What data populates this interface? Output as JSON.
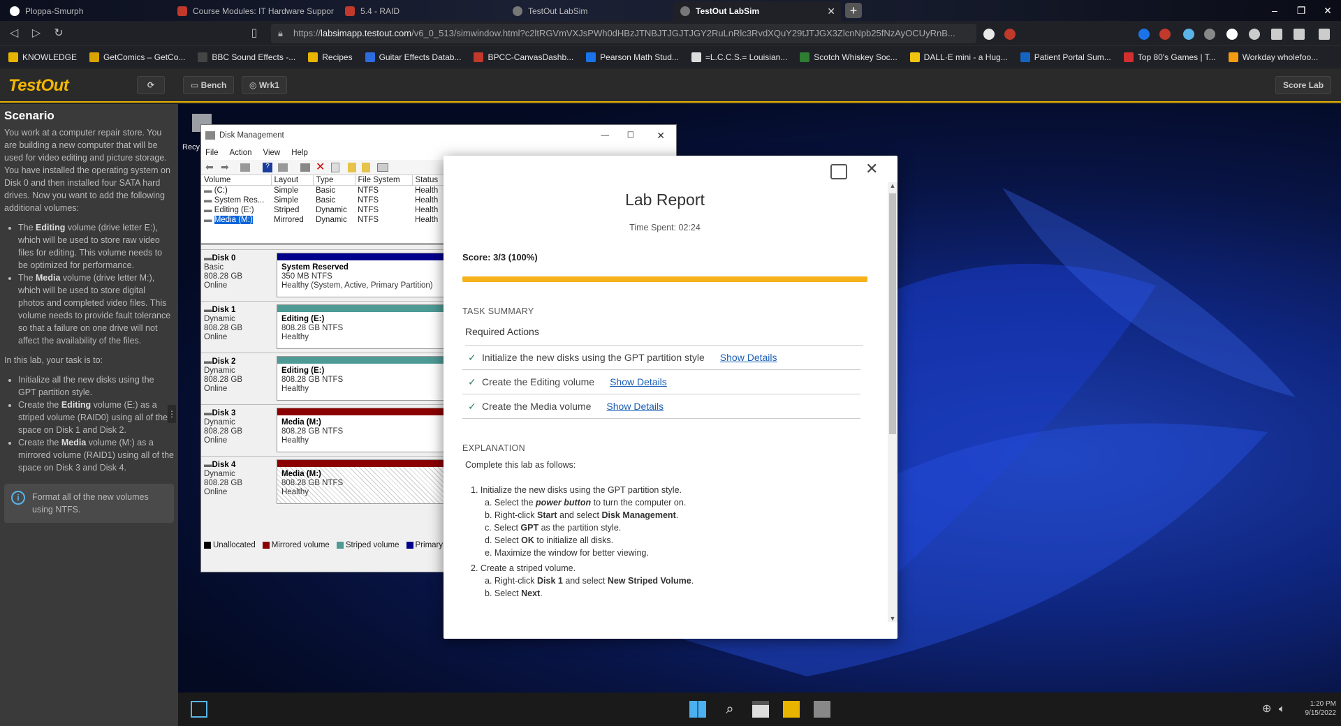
{
  "browser": {
    "tabs": [
      {
        "title": "Ploppa-Smurph",
        "color": "#444"
      },
      {
        "title": "Course Modules: IT Hardware Suppor",
        "color": "#c0392b"
      },
      {
        "title": "5.4 - RAID",
        "color": "#c0392b"
      },
      {
        "title": "TestOut LabSim",
        "color": "#777"
      },
      {
        "title": "TestOut LabSim",
        "color": "#777",
        "active": true
      }
    ],
    "url_prefix": "https://",
    "url_host": "labsimapp.testout.com",
    "url_rest": "/v6_0_513/simwindow.html?c2ltRGVmVXJsPWh0dHBzJTNBJTJGJTJGY2RuLnRlc3RvdXQuY29tJTJGX3ZlcnNpb25fNzAyOCUyRnB...",
    "bookmarks": [
      {
        "label": "KNOWLEDGE",
        "color": "#e8b400"
      },
      {
        "label": "GetComics – GetCo...",
        "color": "#d9a400"
      },
      {
        "label": "BBC Sound Effects -...",
        "color": "#444"
      },
      {
        "label": "Recipes",
        "color": "#e8b400"
      },
      {
        "label": "Guitar Effects Datab...",
        "color": "#2d6cdf"
      },
      {
        "label": "BPCC-CanvasDashb...",
        "color": "#c0392b"
      },
      {
        "label": "Pearson Math Stud...",
        "color": "#1a73e8"
      },
      {
        "label": "=L.C.C.S.= Louisian...",
        "color": "#ddd"
      },
      {
        "label": "Scotch Whiskey Soc...",
        "color": "#2e7d32"
      },
      {
        "label": "DALL·E mini - a Hug...",
        "color": "#f1c40f"
      },
      {
        "label": "Patient Portal Sum...",
        "color": "#1565c0"
      },
      {
        "label": "Top 80's Games | T...",
        "color": "#d32f2f"
      },
      {
        "label": "Workday wholefoo...",
        "color": "#f39c12"
      }
    ]
  },
  "app": {
    "logo": "TestOut",
    "bench": "Bench",
    "wrk": "Wrk1",
    "score_lab": "Score Lab"
  },
  "scenario": {
    "heading": "Scenario",
    "intro": "You work at a computer repair store. You are building a new computer that will be used for video editing and picture storage. You have installed the operating system on Disk 0 and then installed four SATA hard drives. Now you want to add the following additional volumes:",
    "vol_items": [
      {
        "pre": "The ",
        "bold": "Editing",
        "post": " volume (drive letter E:), which will be used to store raw video files for editing. This volume needs to be optimized for performance."
      },
      {
        "pre": "The ",
        "bold": "Media",
        "post": " volume (drive letter M:), which will be used to store digital photos and completed video files. This volume needs to provide fault tolerance so that a failure on one drive will not affect the availability of the files."
      }
    ],
    "task_intro": "In this lab, your task is to:",
    "tasks": [
      {
        "pre": "Initialize all the new disks using the GPT partition style.",
        "bold": "",
        "post": ""
      },
      {
        "pre": "Create the ",
        "bold": "Editing",
        "post": " volume (E:) as a striped volume (RAID0) using all of the space on Disk 1 and Disk 2."
      },
      {
        "pre": "Create the ",
        "bold": "Media",
        "post": " volume (M:) as a mirrored volume (RAID1) using all of the space on Disk 3 and Disk 4."
      }
    ],
    "tip": "Format all of the new volumes using NTFS."
  },
  "desktop": {
    "recycle": "Recy"
  },
  "disk_mgmt": {
    "title": "Disk Management",
    "menus": [
      "File",
      "Action",
      "View",
      "Help"
    ],
    "columns": [
      "Volume",
      "Layout",
      "Type",
      "File System",
      "Status"
    ],
    "volumes": [
      {
        "name": "(C:)",
        "layout": "Simple",
        "type": "Basic",
        "fs": "NTFS",
        "status": "Health"
      },
      {
        "name": "System Res...",
        "layout": "Simple",
        "type": "Basic",
        "fs": "NTFS",
        "status": "Health"
      },
      {
        "name": "Editing (E:)",
        "layout": "Striped",
        "type": "Dynamic",
        "fs": "NTFS",
        "status": "Health"
      },
      {
        "name": "Media (M:)",
        "layout": "Mirrored",
        "type": "Dynamic",
        "fs": "NTFS",
        "status": "Health"
      }
    ],
    "disks": [
      {
        "name": "Disk 0",
        "kind": "Basic",
        "size": "808.28 GB",
        "state": "Online",
        "part": "System Reserved",
        "detail": "350 MB NTFS",
        "health": "Healthy (System, Active, Primary Partition)",
        "bar": "#00008b"
      },
      {
        "name": "Disk 1",
        "kind": "Dynamic",
        "size": "808.28 GB",
        "state": "Online",
        "part": "Editing (E:)",
        "detail": "808.28 GB NTFS",
        "health": "Healthy",
        "bar": "#4e9a95"
      },
      {
        "name": "Disk 2",
        "kind": "Dynamic",
        "size": "808.28 GB",
        "state": "Online",
        "part": "Editing (E:)",
        "detail": "808.28 GB NTFS",
        "health": "Healthy",
        "bar": "#4e9a95"
      },
      {
        "name": "Disk 3",
        "kind": "Dynamic",
        "size": "808.28 GB",
        "state": "Online",
        "part": "Media (M:)",
        "detail": "808.28 GB NTFS",
        "health": "Healthy",
        "bar": "#8b0000"
      },
      {
        "name": "Disk 4",
        "kind": "Dynamic",
        "size": "808.28 GB",
        "state": "Online",
        "part": "Media (M:)",
        "detail": "808.28 GB NTFS",
        "health": "Healthy",
        "bar": "#8b0000"
      }
    ],
    "legend": [
      {
        "label": "Unallocated",
        "color": "#000"
      },
      {
        "label": "Mirrored volume",
        "color": "#8b0000"
      },
      {
        "label": "Striped volume",
        "color": "#4e9a95"
      },
      {
        "label": "Primary",
        "color": "#00008b"
      }
    ]
  },
  "report": {
    "title": "Lab Report",
    "time_spent": "Time Spent: 02:24",
    "score": "Score: 3/3 (100%)",
    "score_progress": 1.0,
    "task_summary": "TASK SUMMARY",
    "required": "Required Actions",
    "actions": [
      {
        "label": "Initialize the new disks using the GPT partition style",
        "link": "Show Details"
      },
      {
        "label": "Create the Editing volume",
        "link": "Show Details"
      },
      {
        "label": "Create the Media volume",
        "link": "Show Details"
      }
    ],
    "explanation": "EXPLANATION",
    "exp_intro": "Complete this lab as follows:",
    "step1": "1. Initialize the new disks using the GPT partition style.",
    "step1_subs": [
      {
        "pre": "a. Select the ",
        "bold": "power button",
        "italic": true,
        "post": " to turn the computer on."
      },
      {
        "pre": "b. Right-click ",
        "bold": "Start",
        "post": " and select ",
        "bold2": "Disk Management",
        "post2": "."
      },
      {
        "pre": "c. Select ",
        "bold": "GPT",
        "post": " as the partition style."
      },
      {
        "pre": "d. Select ",
        "bold": "OK",
        "post": " to initialize all disks."
      },
      {
        "pre": "e. Maximize the window for better viewing.",
        "bold": "",
        "post": ""
      }
    ],
    "step2": "2. Create a striped volume.",
    "step2_subs": [
      {
        "pre": "a. Right-click ",
        "bold": "Disk 1",
        "post": " and select ",
        "bold2": "New Striped Volume",
        "post2": "."
      },
      {
        "pre": "b. Select ",
        "bold": "Next",
        "post": "."
      }
    ]
  },
  "taskbar": {
    "time": "1:20 PM",
    "date": "9/15/2022"
  }
}
